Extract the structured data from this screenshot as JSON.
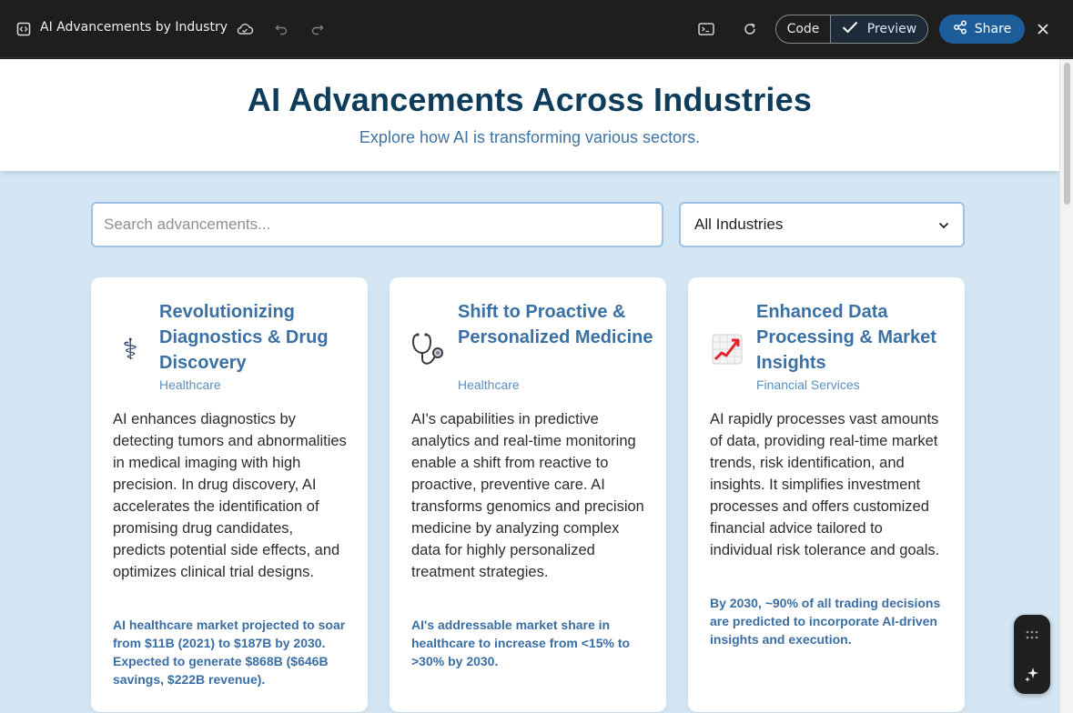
{
  "app": {
    "doc_title": "AI Advancements by Industry",
    "code_label": "Code",
    "preview_label": "Preview",
    "share_label": "Share"
  },
  "page": {
    "title": "AI Advancements Across Industries",
    "subtitle": "Explore how AI is transforming various sectors."
  },
  "filters": {
    "search_placeholder": "Search advancements...",
    "industry_selected": "All Industries"
  },
  "cards": [
    {
      "icon": "caduceus-icon",
      "glyph": "⚕",
      "title": "Revolutionizing Diagnostics & Drug Discovery",
      "sector": "Healthcare",
      "description": "AI enhances diagnostics by detecting tumors and abnormalities in medical imaging with high precision. In drug discovery, AI accelerates the identification of promising drug candidates, predicts potential side effects, and optimizes clinical trial designs.",
      "stat": "AI healthcare market projected to soar from $11B (2021) to $187B by 2030. Expected to generate $868B ($646B savings, $222B revenue)."
    },
    {
      "icon": "stethoscope-icon",
      "title": "Shift to Proactive & Personalized Medicine",
      "sector": "Healthcare",
      "description": "AI's capabilities in predictive analytics and real-time monitoring enable a shift from reactive to proactive, preventive care. AI transforms genomics and precision medicine by analyzing complex data for highly personalized treatment strategies.",
      "stat": "AI's addressable market share in healthcare to increase from <15% to >30% by 2030."
    },
    {
      "icon": "chart-increasing-icon",
      "title": "Enhanced Data Processing & Market Insights",
      "sector": "Financial Services",
      "description": "AI rapidly processes vast amounts of data, providing real-time market trends, risk identification, and insights. It simplifies investment processes and offers customized financial advice tailored to individual risk tolerance and goals.",
      "stat": "By 2030, ~90% of all trading decisions are predicted to incorporate AI-driven insights and execution."
    }
  ],
  "colors": {
    "page_bg": "#d4e6f4",
    "title": "#0e3d5c",
    "accent": "#3a70a3",
    "share_button": "#1c5c99"
  }
}
